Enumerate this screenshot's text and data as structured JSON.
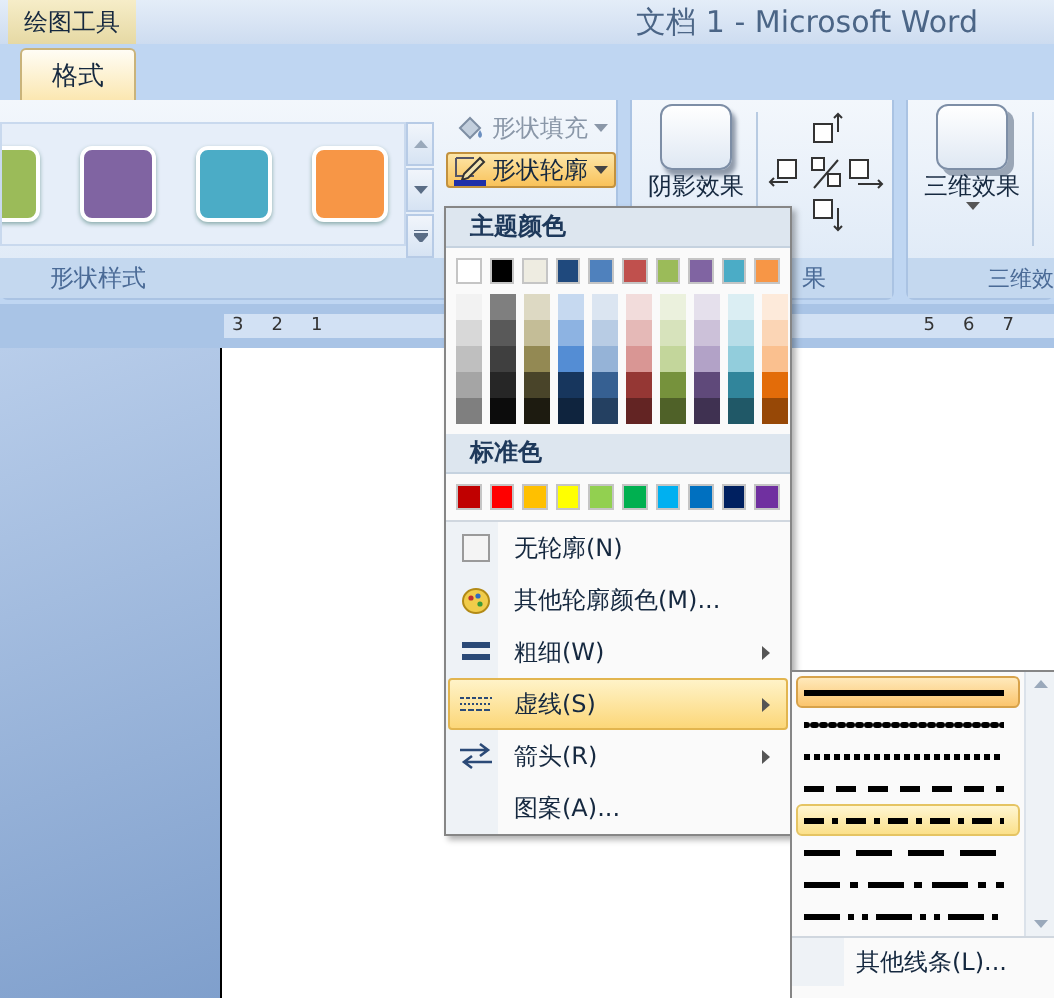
{
  "title_bar": {
    "context_tab": "绘图工具",
    "title": "文档 1 - Microsoft Word"
  },
  "ribbon_tabs": [
    {
      "label": "格式",
      "selected": true
    }
  ],
  "shape_styles": {
    "label": "形状样式",
    "swatches": [
      {
        "color": "#9bbb59"
      },
      {
        "color": "#8064a2"
      },
      {
        "color": "#4bacc6"
      },
      {
        "color": "#f79646"
      }
    ],
    "fill_button": {
      "label": "形状填充",
      "disabled": true
    },
    "outline_button": {
      "label": "形状轮廓",
      "open": true
    }
  },
  "shadow_group": {
    "button": "阴影效果",
    "label": "果"
  },
  "threed_group": {
    "button": "三维效果",
    "label": "三维效"
  },
  "ruler": {
    "left_numbers": [
      "3",
      "2",
      "1"
    ],
    "right_numbers": [
      "5",
      "6",
      "7"
    ]
  },
  "outline_menu": {
    "theme_header": "主题颜色",
    "theme_colors": [
      {
        "color": "#ffffff",
        "shades": [
          {
            "color": "#f2f2f2"
          },
          {
            "color": "#d8d8d8"
          },
          {
            "color": "#bfbfbf"
          },
          {
            "color": "#a5a5a5"
          },
          {
            "color": "#7f7f7f"
          }
        ]
      },
      {
        "color": "#000000",
        "shades": [
          {
            "color": "#7f7f7f"
          },
          {
            "color": "#595959"
          },
          {
            "color": "#3f3f3f"
          },
          {
            "color": "#262626"
          },
          {
            "color": "#0c0c0c"
          }
        ]
      },
      {
        "color": "#eeece1",
        "shades": [
          {
            "color": "#ddd9c3"
          },
          {
            "color": "#c4bd97"
          },
          {
            "color": "#938953"
          },
          {
            "color": "#494429"
          },
          {
            "color": "#1d1b10"
          }
        ]
      },
      {
        "color": "#1f497d",
        "shades": [
          {
            "color": "#c6d9f0"
          },
          {
            "color": "#8db3e2"
          },
          {
            "color": "#548dd4"
          },
          {
            "color": "#17365d"
          },
          {
            "color": "#0f243e"
          }
        ]
      },
      {
        "color": "#4f81bd",
        "shades": [
          {
            "color": "#dbe5f1"
          },
          {
            "color": "#b8cce4"
          },
          {
            "color": "#95b3d7"
          },
          {
            "color": "#366092"
          },
          {
            "color": "#244061"
          }
        ]
      },
      {
        "color": "#c0504d",
        "shades": [
          {
            "color": "#f2dcdb"
          },
          {
            "color": "#e5b9b7"
          },
          {
            "color": "#d99694"
          },
          {
            "color": "#953734"
          },
          {
            "color": "#632423"
          }
        ]
      },
      {
        "color": "#9bbb59",
        "shades": [
          {
            "color": "#ebf1dd"
          },
          {
            "color": "#d7e3bc"
          },
          {
            "color": "#c3d69b"
          },
          {
            "color": "#76923c"
          },
          {
            "color": "#4f6128"
          }
        ]
      },
      {
        "color": "#8064a2",
        "shades": [
          {
            "color": "#e5e0ec"
          },
          {
            "color": "#ccc1d9"
          },
          {
            "color": "#b2a2c7"
          },
          {
            "color": "#5f497a"
          },
          {
            "color": "#3f3151"
          }
        ]
      },
      {
        "color": "#4bacc6",
        "shades": [
          {
            "color": "#dbeef3"
          },
          {
            "color": "#b7dde8"
          },
          {
            "color": "#92cddc"
          },
          {
            "color": "#31859b"
          },
          {
            "color": "#205867"
          }
        ]
      },
      {
        "color": "#f79646",
        "shades": [
          {
            "color": "#fdeada"
          },
          {
            "color": "#fbd5b5"
          },
          {
            "color": "#fac08f"
          },
          {
            "color": "#e36c09"
          },
          {
            "color": "#974806"
          }
        ]
      }
    ],
    "standard_header": "标准色",
    "standard_colors": [
      {
        "color": "#c00000"
      },
      {
        "color": "#ff0000"
      },
      {
        "color": "#ffc000"
      },
      {
        "color": "#ffff00"
      },
      {
        "color": "#92d050"
      },
      {
        "color": "#00b050"
      },
      {
        "color": "#00b0f0"
      },
      {
        "color": "#0070c0"
      },
      {
        "color": "#002060"
      },
      {
        "color": "#7030a0"
      }
    ],
    "items": [
      {
        "kind": "no-outline",
        "label": "无轮廓(N)",
        "submenu": false,
        "selected": false
      },
      {
        "kind": "more-colors",
        "label": "其他轮廓颜色(M)...",
        "submenu": false,
        "selected": false
      },
      {
        "kind": "weight",
        "label": "粗细(W)",
        "submenu": true,
        "selected": false
      },
      {
        "kind": "dash",
        "label": "虚线(S)",
        "submenu": true,
        "selected": true
      },
      {
        "kind": "arrows",
        "label": "箭头(R)",
        "submenu": true,
        "selected": false
      },
      {
        "kind": "plain",
        "label": "图案(A)...",
        "submenu": false,
        "selected": false
      }
    ]
  },
  "dash_submenu": {
    "styles": [
      {
        "kind": "solid",
        "selected": true,
        "hovered": false
      },
      {
        "kind": "round-dot",
        "selected": false,
        "hovered": false
      },
      {
        "kind": "square-dot",
        "selected": false,
        "hovered": false
      },
      {
        "kind": "dash",
        "selected": false,
        "hovered": false
      },
      {
        "kind": "dash-dot",
        "selected": false,
        "hovered": true
      },
      {
        "kind": "long-dash",
        "selected": false,
        "hovered": false
      },
      {
        "kind": "long-dash-dot",
        "selected": false,
        "hovered": false
      },
      {
        "kind": "long-dash-dot-dot",
        "selected": false,
        "hovered": false
      }
    ],
    "more_item": "其他线条(L)..."
  }
}
